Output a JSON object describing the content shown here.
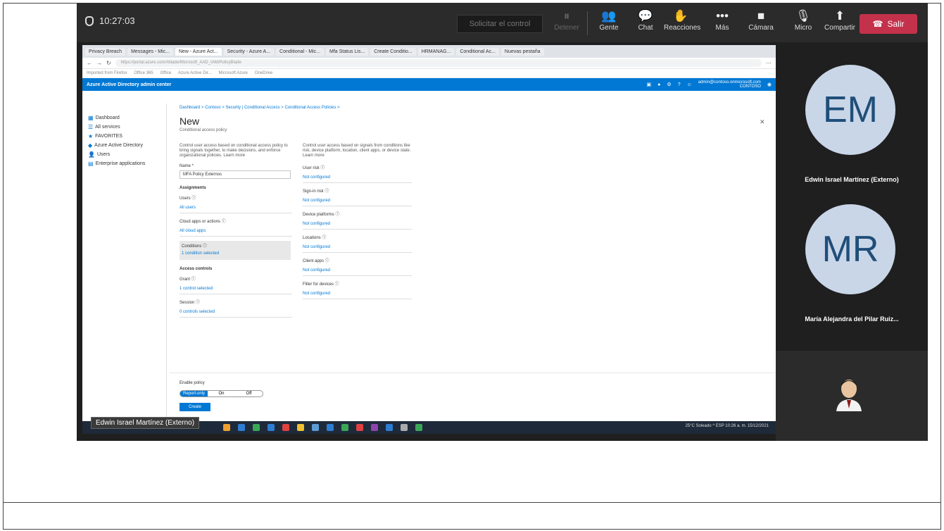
{
  "meeting": {
    "timer": "10:27:03",
    "take_control": "Solicitar el control",
    "toolbar": [
      {
        "label": "Detener",
        "icon": "pause-icon",
        "dim": true
      },
      {
        "label": "Gente",
        "icon": "people-icon",
        "dim": false
      },
      {
        "label": "Chat",
        "icon": "chat-icon",
        "dim": false
      },
      {
        "label": "Reacciones",
        "icon": "reactions-icon",
        "dim": false
      },
      {
        "label": "Más",
        "icon": "more-icon",
        "dim": false
      },
      {
        "label": "Cámara",
        "icon": "camera-icon",
        "dim": false
      },
      {
        "label": "Micro",
        "icon": "mic-icon",
        "dim": false
      },
      {
        "label": "Compartir",
        "icon": "share-icon",
        "dim": false
      }
    ],
    "leave": "Salir",
    "presenter_label": "Edwin Israel Martínez (Externo)"
  },
  "browser": {
    "tabs": [
      "Privacy Breach",
      "Messages - Mic...",
      "New - Azure Act...",
      "Security - Azure A...",
      "Conditional - Mic...",
      "Mfa Status Lis...",
      "Create Conditio...",
      "HRMANAG...",
      "Conditional Ac...",
      "Nuevas pestaña"
    ],
    "url": "https://portal.azure.com/#blade/Microsoft_AAD_IAM/PolicyBlade",
    "bookmarks": [
      "Imported from Firefox",
      "Office 365",
      "Office",
      "Azure Active Dir...",
      "Microsoft Azure",
      "OneDrive"
    ],
    "portal_title": "Azure Active Directory admin center",
    "account": "admin@contoso.onmicrosoft.com",
    "account_tenant": "CONTOSO"
  },
  "portal": {
    "sidebar": [
      {
        "label": "Dashboard",
        "icon": "dashboard-icon"
      },
      {
        "label": "All services",
        "icon": "grid-icon"
      },
      {
        "label": "FAVORITES",
        "icon": "star-icon"
      },
      {
        "label": "Azure Active Directory",
        "icon": "aad-icon"
      },
      {
        "label": "Users",
        "icon": "user-icon"
      },
      {
        "label": "Enterprise applications",
        "icon": "apps-icon"
      }
    ],
    "breadcrumb": "Dashboard > Contoso > Security | Conditional Access > Conditional Access Policies >",
    "title": "New",
    "subtitle": "Conditional access policy",
    "left_desc": "Control user access based on conditional access policy to bring signals together, to make decisions, and enforce organizational policies. Learn more",
    "right_desc": "Control user access based on signals from conditions like risk, device platform, location, client apps, or device state. Learn more",
    "name_label": "Name *",
    "name_value": "MFA Policy Externos",
    "assignments": "Assignments",
    "left_fields": [
      {
        "label": "Users ⓘ",
        "value": "All users"
      },
      {
        "label": "Cloud apps or actions ⓘ",
        "value": "All cloud apps"
      }
    ],
    "conditions_label": "Conditions ⓘ",
    "conditions_value": "1 condition selected",
    "access_controls": "Access controls",
    "access_fields": [
      {
        "label": "Grant ⓘ",
        "value": "1 control selected"
      },
      {
        "label": "Session ⓘ",
        "value": "0 controls selected"
      }
    ],
    "right_fields": [
      {
        "label": "User risk ⓘ",
        "value": "Not configured"
      },
      {
        "label": "Sign-in risk ⓘ",
        "value": "Not configured"
      },
      {
        "label": "Device platforms ⓘ",
        "value": "Not configured"
      },
      {
        "label": "Locations ⓘ",
        "value": "Not configured"
      },
      {
        "label": "Client apps ⓘ",
        "value": "Not configured"
      },
      {
        "label": "Filter for devices ⓘ",
        "value": "Not configured"
      }
    ],
    "enable_policy": "Enable policy",
    "toggle": [
      "Report-only",
      "On",
      "Off"
    ],
    "create": "Create"
  },
  "taskbar": {
    "tray": "25°C Soleado  ^  ESP  10:26 a. m. 15/12/2021"
  },
  "participants": [
    {
      "initials": "EM",
      "name": "Edwin Israel Martínez (Externo)"
    },
    {
      "initials": "MR",
      "name": "María Alejandra del Pilar Ruiz..."
    }
  ]
}
